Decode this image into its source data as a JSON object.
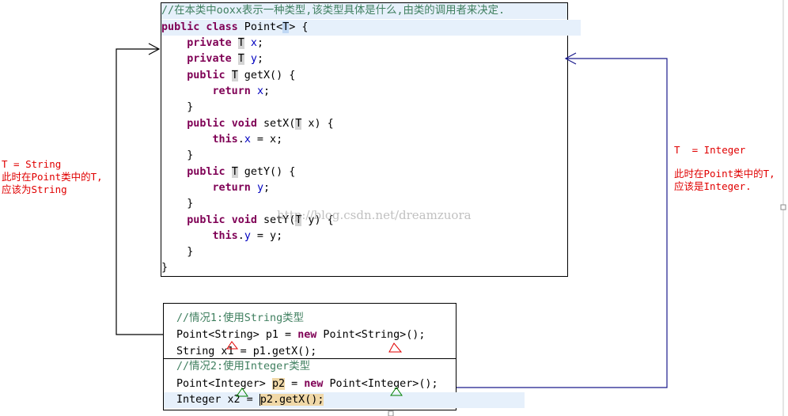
{
  "class_code": {
    "comment": "//在本类中ooxx表示一种类型,该类型具体是什么,由类的调用者来决定.",
    "decl_a": "public class",
    "decl_b": " Point<",
    "type_param": "T",
    "decl_c": "> {",
    "kw_private": "private",
    "kw_public": "public",
    "kw_void": "void",
    "kw_return": "return",
    "kw_this": "this",
    "t": "T",
    "field_x": "x",
    "field_y": "y",
    "semi": ";",
    "getx_name": " getX() {",
    "gety_name": " getY() {",
    "setx_name": " setX(",
    "sety_name": " setY(",
    "param_x": " x) {",
    "param_y": " y) {",
    "dot": ".",
    "assign_x": " = x;",
    "assign_y": " = y;",
    "brace": "}"
  },
  "case1": {
    "comment": "//情况1:使用String类型",
    "line1_a": "Point<String> p1 = ",
    "kw_new": "new",
    "line1_b": " Point<String>();",
    "line2": "String x1 = p1.getX();"
  },
  "case2": {
    "comment": "//情况2:使用Integer类型",
    "line1_a": "Point<Integer> ",
    "var_p2": "p2",
    "line1_b": " = ",
    "kw_new": "new",
    "line1_c": " Point<Integer>();",
    "line2_a": "Integer x2 = ",
    "line2_b": "p2.getX();"
  },
  "left_note": {
    "line1": "T = String",
    "line2": "此时在Point类中的T,",
    "line3": "应该为String"
  },
  "right_note": {
    "line1": "T  = Integer",
    "line2": "此时在Point类中的T,",
    "line3": "应该是Integer."
  },
  "watermark": "http://blog.csdn.net/dreamzuora",
  "colors": {
    "comment": "#3f7f5f",
    "keyword": "#7f0055",
    "field": "#0000c0",
    "note": "#e00000",
    "arrow_left": "#000000",
    "arrow_right": "#1a1a8c"
  }
}
